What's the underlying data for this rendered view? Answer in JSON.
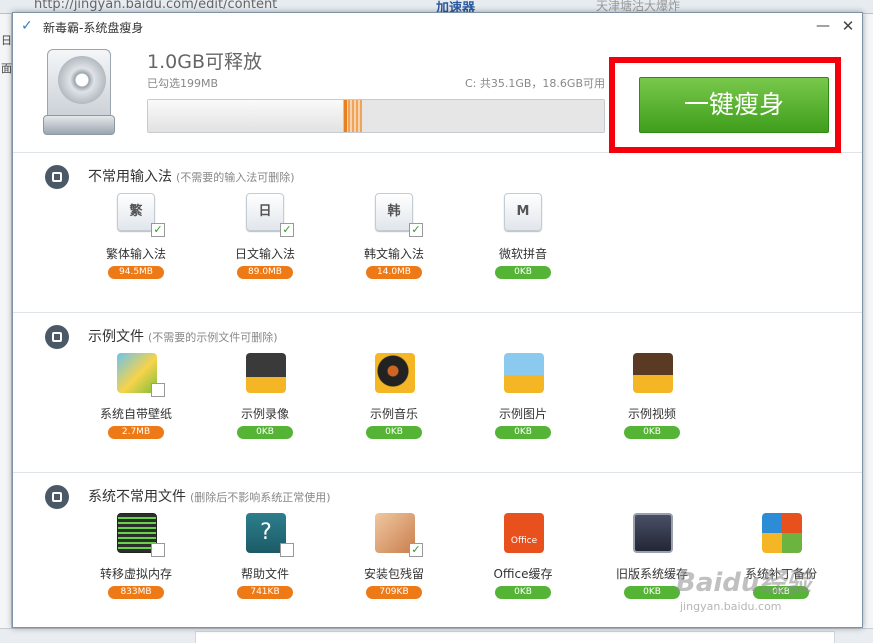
{
  "browser": {
    "url_text": "http://jingyan.baidu.com/edit/content",
    "speed_label": "加速器",
    "search_placeholder": "天津塘沽大爆炸",
    "side_chars": [
      "日",
      "面"
    ]
  },
  "dialog": {
    "title": "新毒霸-系统盘瘦身",
    "minimize": "—",
    "close": "✕"
  },
  "header": {
    "release": "1.0GB可释放",
    "selected": "已勾选199MB",
    "disk": "C: 共35.1GB，18.6GB可用",
    "slim_button": "一键瘦身"
  },
  "sections": [
    {
      "title": "不常用输入法",
      "note": "(不需要的输入法可删除)",
      "items": [
        {
          "name": "繁体输入法",
          "glyph": "繁",
          "size": "94.5MB",
          "checked": true,
          "color": "orange"
        },
        {
          "name": "日文输入法",
          "glyph": "日",
          "size": "89.0MB",
          "checked": true,
          "color": "orange"
        },
        {
          "name": "韩文输入法",
          "glyph": "韩",
          "size": "14.0MB",
          "checked": true,
          "color": "orange"
        },
        {
          "name": "微软拼音",
          "glyph": "M",
          "size": "0KB",
          "checked": false,
          "color": "green"
        }
      ]
    },
    {
      "title": "示例文件",
      "note": "(不需要的示例文件可删除)",
      "items": [
        {
          "name": "系统自带壁纸",
          "icon": "wallpaper-icon",
          "size": "2.7MB",
          "checked": false,
          "color": "orange"
        },
        {
          "name": "示例录像",
          "icon": "video-folder-icon",
          "size": "0KB",
          "checked": false,
          "color": "green"
        },
        {
          "name": "示例音乐",
          "icon": "music-folder-icon",
          "size": "0KB",
          "checked": false,
          "color": "green"
        },
        {
          "name": "示例图片",
          "icon": "picture-folder-icon",
          "size": "0KB",
          "checked": false,
          "color": "green"
        },
        {
          "name": "示例视频",
          "icon": "film-folder-icon",
          "size": "0KB",
          "checked": false,
          "color": "green"
        }
      ]
    },
    {
      "title": "系统不常用文件",
      "note": "(删除后不影响系统正常使用)",
      "items": [
        {
          "name": "转移虚拟内存",
          "icon": "memory-icon",
          "size": "833MB",
          "checked": false,
          "color": "orange"
        },
        {
          "name": "帮助文件",
          "icon": "help-icon",
          "glyph": "?",
          "size": "741KB",
          "checked": false,
          "color": "orange"
        },
        {
          "name": "安装包残留",
          "icon": "package-icon",
          "size": "709KB",
          "checked": true,
          "color": "orange"
        },
        {
          "name": "Office缓存",
          "icon": "office-icon",
          "glyph": "Office",
          "size": "0KB",
          "checked": false,
          "color": "green"
        },
        {
          "name": "旧版系统缓存",
          "icon": "old-system-icon",
          "size": "0KB",
          "checked": false,
          "color": "green"
        },
        {
          "name": "系统补丁备份",
          "icon": "windows-update-icon",
          "size": "0KB",
          "checked": false,
          "color": "green"
        }
      ]
    }
  ],
  "watermark": {
    "text": "Baidu经验",
    "url": "jingyan.baidu.com"
  },
  "colors": {
    "accent_green": "#4ead25",
    "highlight_red": "#f4000c",
    "size_orange": "#ed7a16",
    "size_green": "#55b436"
  }
}
